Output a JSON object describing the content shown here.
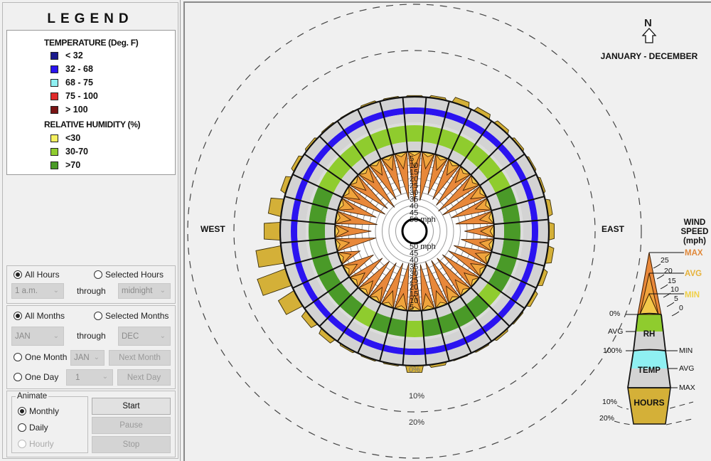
{
  "legend": {
    "title": "LEGEND",
    "temperature_heading": "TEMPERATURE (Deg. F)",
    "temperature_items": [
      {
        "label": "< 32",
        "color": "#1a1a8c"
      },
      {
        "label": "32  -  68",
        "color": "#2b13f0"
      },
      {
        "label": "68  -  75",
        "color": "#8ff0f2"
      },
      {
        "label": "75  - 100",
        "color": "#e02a2a"
      },
      {
        "label": "> 100",
        "color": "#7a1414"
      }
    ],
    "humidity_heading": "RELATIVE HUMIDITY (%)",
    "humidity_items": [
      {
        "label": "<30",
        "color": "#f5f060"
      },
      {
        "label": "30-70",
        "color": "#8fcc2e"
      },
      {
        "label": ">70",
        "color": "#4a9a28"
      }
    ]
  },
  "hours": {
    "all_label": "All Hours",
    "selected_label": "Selected Hours",
    "all_checked": true,
    "from": "1 a.m.",
    "through": "through",
    "to": "midnight"
  },
  "months": {
    "all_label": "All Months",
    "selected_label": "Selected Months",
    "all_checked": true,
    "from": "JAN",
    "through": "through",
    "to": "DEC",
    "one_month_label": "One Month",
    "one_month_value": "JAN",
    "next_month": "Next Month",
    "one_day_label": "One Day",
    "one_day_value": "1",
    "next_day": "Next Day"
  },
  "animate": {
    "title": "Animate",
    "options": [
      {
        "label": "Monthly",
        "checked": true,
        "disabled": false
      },
      {
        "label": "Daily",
        "checked": false,
        "disabled": false
      },
      {
        "label": "Hourly",
        "checked": false,
        "disabled": true
      }
    ],
    "start": "Start",
    "pause": "Pause",
    "stop": "Stop"
  },
  "chart_data": {
    "type": "wind-wheel",
    "title": "JANUARY - DECEMBER",
    "north_label": "N",
    "direction_labels": {
      "west": "WEST",
      "east": "EAST"
    },
    "wind_speed_ticks_mph": [
      5,
      10,
      15,
      20,
      25,
      30,
      35,
      40,
      45,
      50
    ],
    "wind_speed_unit": "mph",
    "hours_scale_ticks": [
      "0%",
      "10%",
      "20%"
    ],
    "sector_count": 36,
    "sector_width_deg": 10,
    "colors": {
      "temp_band": "#2b13f0",
      "rh_light": "#8fcc2e",
      "rh_dark": "#4a9a28",
      "wind_max": "#e8883a",
      "wind_avg": "#f0a43c",
      "wind_min": "#f4c84a",
      "hours": "#d4b038",
      "gray": "#d3d3d3"
    },
    "sectors_deg_from_north": [
      0,
      10,
      20,
      30,
      40,
      50,
      60,
      70,
      80,
      90,
      100,
      110,
      120,
      130,
      140,
      150,
      160,
      170,
      180,
      190,
      200,
      210,
      220,
      230,
      240,
      250,
      260,
      270,
      280,
      290,
      300,
      310,
      320,
      330,
      340,
      350
    ],
    "max_wind_mph": [
      38,
      36,
      30,
      32,
      34,
      36,
      35,
      30,
      28,
      22,
      24,
      28,
      30,
      32,
      33,
      34,
      35,
      34,
      36,
      35,
      34,
      32,
      30,
      28,
      24,
      16,
      30,
      27,
      31,
      29,
      34,
      33,
      36,
      32,
      30,
      35
    ],
    "avg_wind_mph": [
      12,
      12,
      11,
      11,
      12,
      12,
      11,
      11,
      10,
      10,
      10,
      11,
      11,
      11,
      12,
      12,
      12,
      12,
      12,
      12,
      12,
      11,
      11,
      11,
      10,
      9,
      10,
      10,
      11,
      11,
      12,
      12,
      12,
      11,
      11,
      12
    ],
    "min_wind_mph": [
      3,
      3,
      3,
      3,
      3,
      3,
      3,
      3,
      3,
      3,
      3,
      3,
      3,
      3,
      3,
      3,
      3,
      3,
      3,
      3,
      3,
      3,
      3,
      3,
      3,
      3,
      3,
      3,
      3,
      3,
      3,
      3,
      3,
      3,
      3,
      3
    ],
    "hours_percent": [
      0.3,
      0.5,
      1.2,
      1.0,
      0.8,
      0.5,
      0.4,
      0.5,
      1.0,
      1.2,
      1.3,
      1.0,
      0.8,
      0.3,
      0.5,
      0.3,
      0.2,
      0.6,
      1.5,
      0.3,
      0.3,
      0.4,
      1.2,
      1.5,
      4.0,
      6.5,
      5.5,
      3.5,
      2.8,
      1.2,
      0.8,
      0.5,
      0.3,
      0.2,
      0.4,
      0.3
    ],
    "rh_category": [
      "light",
      "light",
      "light",
      "light",
      "light",
      "light",
      "light",
      "dark",
      "dark",
      "dark",
      "dark",
      "dark",
      "dark",
      "light",
      "dark",
      "dark",
      "dark",
      "dark",
      "light",
      "dark",
      "dark",
      "light",
      "dark",
      "dark",
      "dark",
      "dark",
      "dark",
      "dark",
      "dark",
      "dark",
      "light",
      "light",
      "light",
      "light",
      "light",
      "light"
    ],
    "temp_category": "32 - 68",
    "scale_legend": {
      "title": "WIND SPEED (mph)",
      "wind_labels": [
        "MAX",
        "AVG",
        "MIN"
      ],
      "wind_ticks": [
        "25",
        "20",
        "15",
        "10",
        "5",
        "0"
      ],
      "rh_labels": [
        "0%",
        "AVG",
        "100%"
      ],
      "rh_name": "RH",
      "temp_labels": [
        "MIN",
        "AVG",
        "MAX"
      ],
      "temp_name": "TEMP",
      "hours_name": "HOURS",
      "hours_ticks": [
        "10%",
        "20%"
      ]
    }
  }
}
